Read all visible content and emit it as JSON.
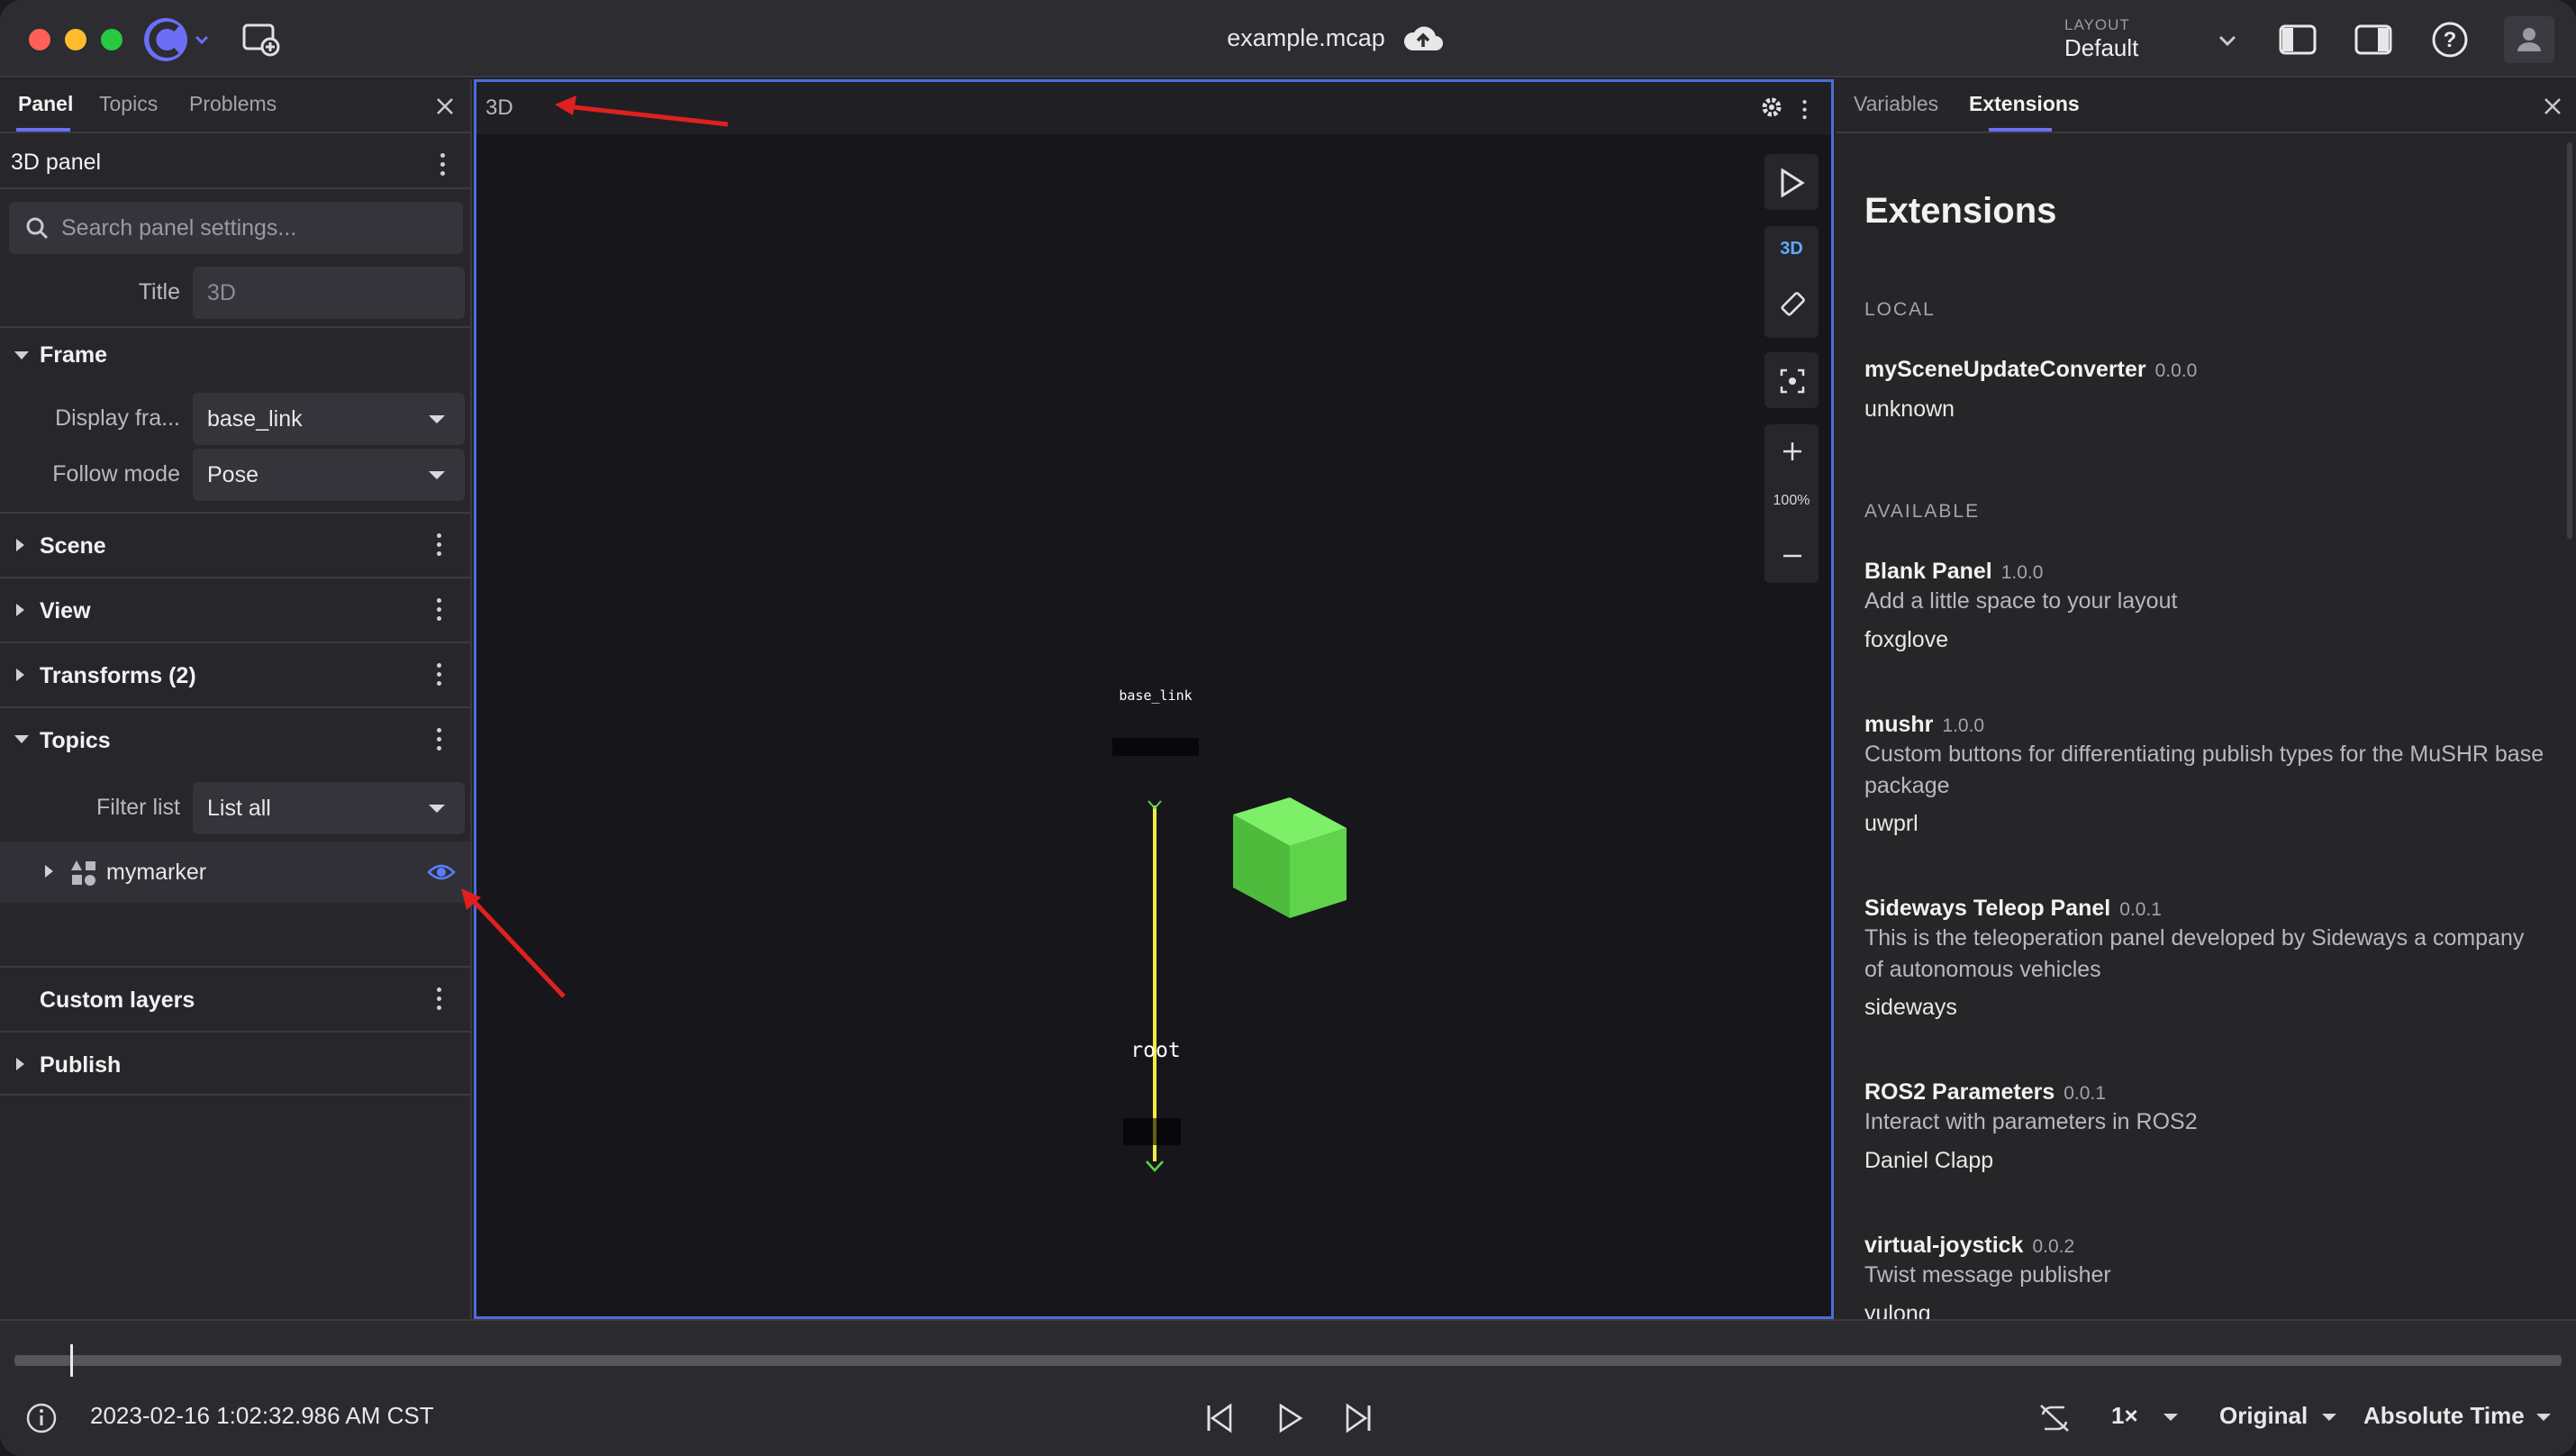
{
  "window": {
    "title": "example.mcap"
  },
  "toolbar": {
    "layout_label": "LAYOUT",
    "layout_value": "Default"
  },
  "left_panel": {
    "tabs": [
      "Panel",
      "Topics",
      "Problems"
    ],
    "panel_title": "3D panel",
    "search_placeholder": "Search panel settings...",
    "title_label": "Title",
    "title_placeholder": "3D",
    "frame": {
      "label": "Frame",
      "display_frame_label": "Display fra...",
      "display_frame_value": "base_link",
      "follow_mode_label": "Follow mode",
      "follow_mode_value": "Pose"
    },
    "sections": {
      "scene": "Scene",
      "view": "View",
      "transforms": "Transforms (2)",
      "topics": "Topics",
      "custom_layers": "Custom layers",
      "publish": "Publish"
    },
    "filter_label": "Filter list",
    "filter_value": "List all",
    "topic_item": "mymarker"
  },
  "center_panel": {
    "title": "3D",
    "mode_3d": "3D",
    "zoom": "100%",
    "scene_labels": {
      "base_link": "base_link",
      "root": "root"
    },
    "cube_color": "#5fd44a"
  },
  "right_panel": {
    "tabs": [
      "Variables",
      "Extensions"
    ],
    "heading": "Extensions",
    "local_caption": "LOCAL",
    "available_caption": "AVAILABLE",
    "local": [
      {
        "name": "mySceneUpdateConverter",
        "version": "0.0.0",
        "author": "unknown"
      }
    ],
    "available": [
      {
        "name": "Blank Panel",
        "version": "1.0.0",
        "description": "Add a little space to your layout",
        "author": "foxglove"
      },
      {
        "name": "mushr",
        "version": "1.0.0",
        "description": "Custom buttons for differentiating publish types for the MuSHR base package",
        "author": "uwprl"
      },
      {
        "name": "Sideways Teleop Panel",
        "version": "0.0.1",
        "description": "This is the teleoperation panel developed by Sideways a company of autonomous vehicles",
        "author": "sideways"
      },
      {
        "name": "ROS2 Parameters",
        "version": "0.0.1",
        "description": "Interact with parameters in ROS2",
        "author": "Daniel Clapp"
      },
      {
        "name": "virtual-joystick",
        "version": "0.0.2",
        "description": "Twist message publisher",
        "author": "yulong"
      }
    ]
  },
  "playback": {
    "timestamp": "2023-02-16 1:02:32.986 AM CST",
    "speed": "1×",
    "mode": "Original",
    "time_format": "Absolute Time"
  },
  "colors": {
    "accent": "#6b6ff5",
    "selection_border": "#4b6dd8",
    "annotation": "#e02020"
  }
}
